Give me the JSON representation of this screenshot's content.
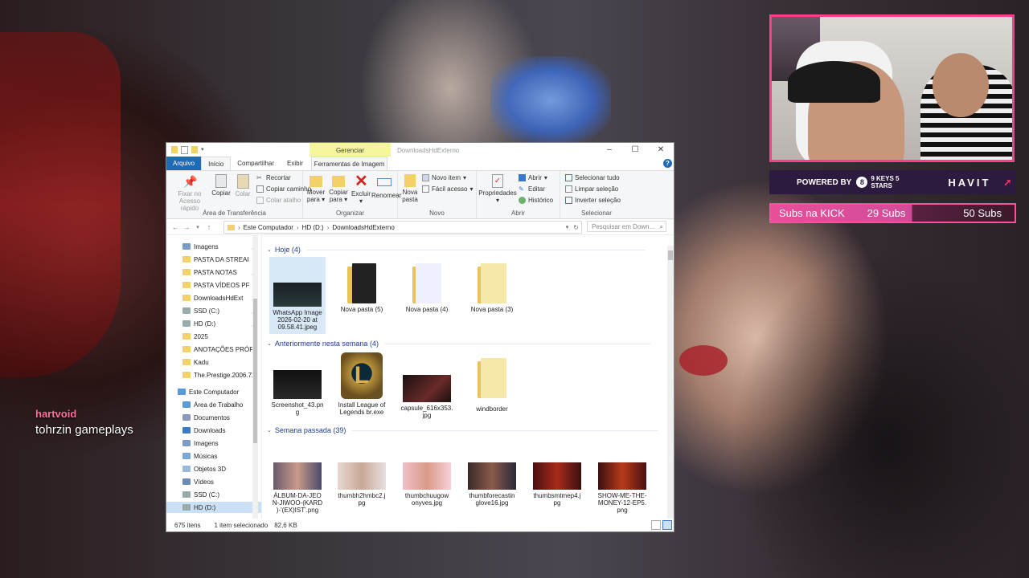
{
  "overlay": {
    "streamer_name": "hartvoid",
    "game_label": "tohrzin gameplays",
    "sponsor": {
      "powered_by": "POWERED BY",
      "brand1_logo": "8",
      "brand1_text": "9 KEYS 5 STARS",
      "brand2": "HAVIT"
    },
    "subs": {
      "label": "Subs na KICK",
      "current": "29 Subs",
      "goal": "50 Subs",
      "progress": 0.58
    }
  },
  "explorer": {
    "contextual_tab_header": "Gerenciar",
    "window_title": "DownloadsHdExterno",
    "window_controls": [
      "–",
      "☐",
      "✕"
    ],
    "tabs": [
      "Arquivo",
      "Início",
      "Compartilhar",
      "Exibir",
      "Ferramentas de Imagem"
    ],
    "ribbon": {
      "groups": [
        "Área de Transferência",
        "Organizar",
        "Novo",
        "Abrir",
        "Selecionar"
      ],
      "pin": "Fixar no Acesso rápido",
      "copy": "Copiar",
      "paste": "Colar",
      "cut": "Recortar",
      "copy_path": "Copiar caminho",
      "paste_shortcut": "Colar atalho",
      "move_to": "Mover para",
      "copy_to": "Copiar para",
      "delete": "Excluir",
      "rename": "Renomear",
      "new_folder": "Nova pasta",
      "new_item": "Novo item",
      "easy_access": "Fácil acesso",
      "properties": "Propriedades",
      "open": "Abrir",
      "edit": "Editar",
      "history": "Histórico",
      "select_all": "Selecionar tudo",
      "select_none": "Limpar seleção",
      "invert_selection": "Inverter seleção"
    },
    "address": {
      "crumbs": [
        "Este Computador",
        "HD (D:)",
        "DownloadsHdExterno"
      ],
      "search_placeholder": "Pesquisar em Down..."
    },
    "nav": [
      {
        "label": "Imagens",
        "pinned": true
      },
      {
        "label": "PASTA DA STREAI",
        "pinned": true
      },
      {
        "label": "PASTA NOTAS",
        "pinned": true
      },
      {
        "label": "PASTA VÍDEOS PF",
        "pinned": true
      },
      {
        "label": "DownloadsHdExt",
        "pinned": true
      },
      {
        "label": "SSD (C:)",
        "pinned": true
      },
      {
        "label": "HD (D:)",
        "pinned": true
      },
      {
        "label": "2025",
        "pinned": false
      },
      {
        "label": "ANOTAÇÕES PRÓPR",
        "pinned": false
      },
      {
        "label": "Kadu",
        "pinned": false
      },
      {
        "label": "The.Prestige.2006.72",
        "pinned": false
      },
      {
        "label": "Este Computador",
        "pinned": false
      },
      {
        "label": "Área de Trabalho",
        "pinned": false
      },
      {
        "label": "Documentos",
        "pinned": false
      },
      {
        "label": "Downloads",
        "pinned": false
      },
      {
        "label": "Imagens",
        "pinned": false
      },
      {
        "label": "Músicas",
        "pinned": false
      },
      {
        "label": "Objetos 3D",
        "pinned": false
      },
      {
        "label": "Vídeos",
        "pinned": false
      },
      {
        "label": "SSD (C:)",
        "pinned": false
      },
      {
        "label": "HD (D:)",
        "pinned": false
      }
    ],
    "groups": [
      {
        "title": "Hoje (4)",
        "items": [
          {
            "name": "WhatsApp Image 2026-02-20 at 09.58.41.jpeg",
            "line1": "WhatsApp Image",
            "line2": "2026-02-20 at",
            "line3": "09.58.41.jpeg",
            "kind": "image"
          },
          {
            "name": "Nova pasta (5)",
            "line1": "Nova pasta (5)",
            "kind": "folder"
          },
          {
            "name": "Nova pasta (4)",
            "line1": "Nova pasta (4)",
            "kind": "folder"
          },
          {
            "name": "Nova pasta (3)",
            "line1": "Nova pasta (3)",
            "kind": "folder"
          }
        ]
      },
      {
        "title": "Anteriormente nesta semana (4)",
        "items": [
          {
            "name": "Screenshot_43.png",
            "line1": "Screenshot_43.pn",
            "line2": "g",
            "kind": "image"
          },
          {
            "name": "Install League of Legends br.exe",
            "line1": "Install League of",
            "line2": "Legends br.exe",
            "kind": "exe"
          },
          {
            "name": "capsule_616x353.jpg",
            "line1": "capsule_616x353.",
            "line2": "jpg",
            "kind": "image"
          },
          {
            "name": "windborder",
            "line1": "windborder",
            "kind": "folder"
          }
        ]
      },
      {
        "title": "Semana passada (39)",
        "items": [
          {
            "line1": "ÁLBUM-DA-JEO",
            "line2": "N-JIWOO-(KARD",
            "line3": ")-'(EX)IST'.png",
            "kind": "image"
          },
          {
            "line1": "thumbh2hmbc2.j",
            "line2": "pg",
            "kind": "image"
          },
          {
            "line1": "thumbchuugow",
            "line2": "onyves.jpg",
            "kind": "image"
          },
          {
            "line1": "thumbforecastin",
            "line2": "glove16.jpg",
            "kind": "image"
          },
          {
            "line1": "thumbsmtmep4.j",
            "line2": "pg",
            "kind": "image"
          },
          {
            "line1": "SHOW-ME-THE-",
            "line2": "MONEY-12-EP5.",
            "line3": "png",
            "kind": "image"
          }
        ]
      }
    ],
    "status": {
      "count": "675 itens",
      "selected": "1 item selecionado",
      "size": "82,6 KB"
    }
  }
}
